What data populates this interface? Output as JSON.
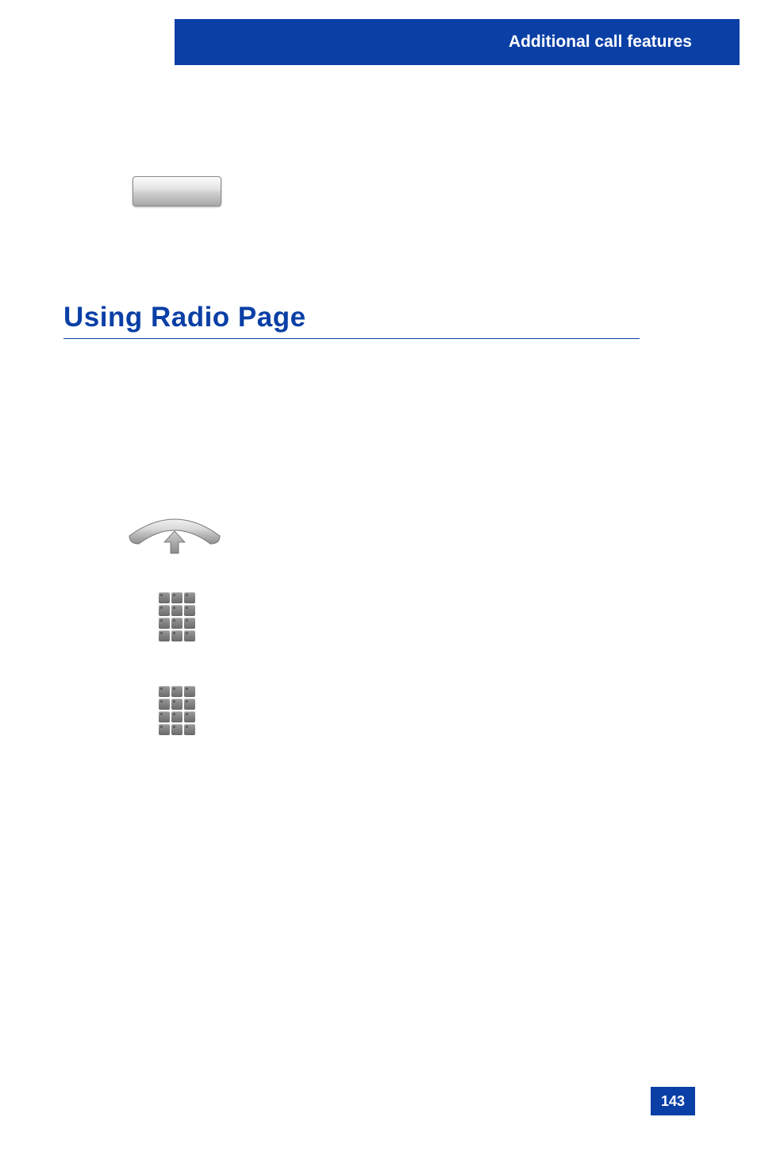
{
  "header": {
    "title": "Additional call features"
  },
  "section": {
    "title": "Using Radio Page"
  },
  "page_number": "143"
}
